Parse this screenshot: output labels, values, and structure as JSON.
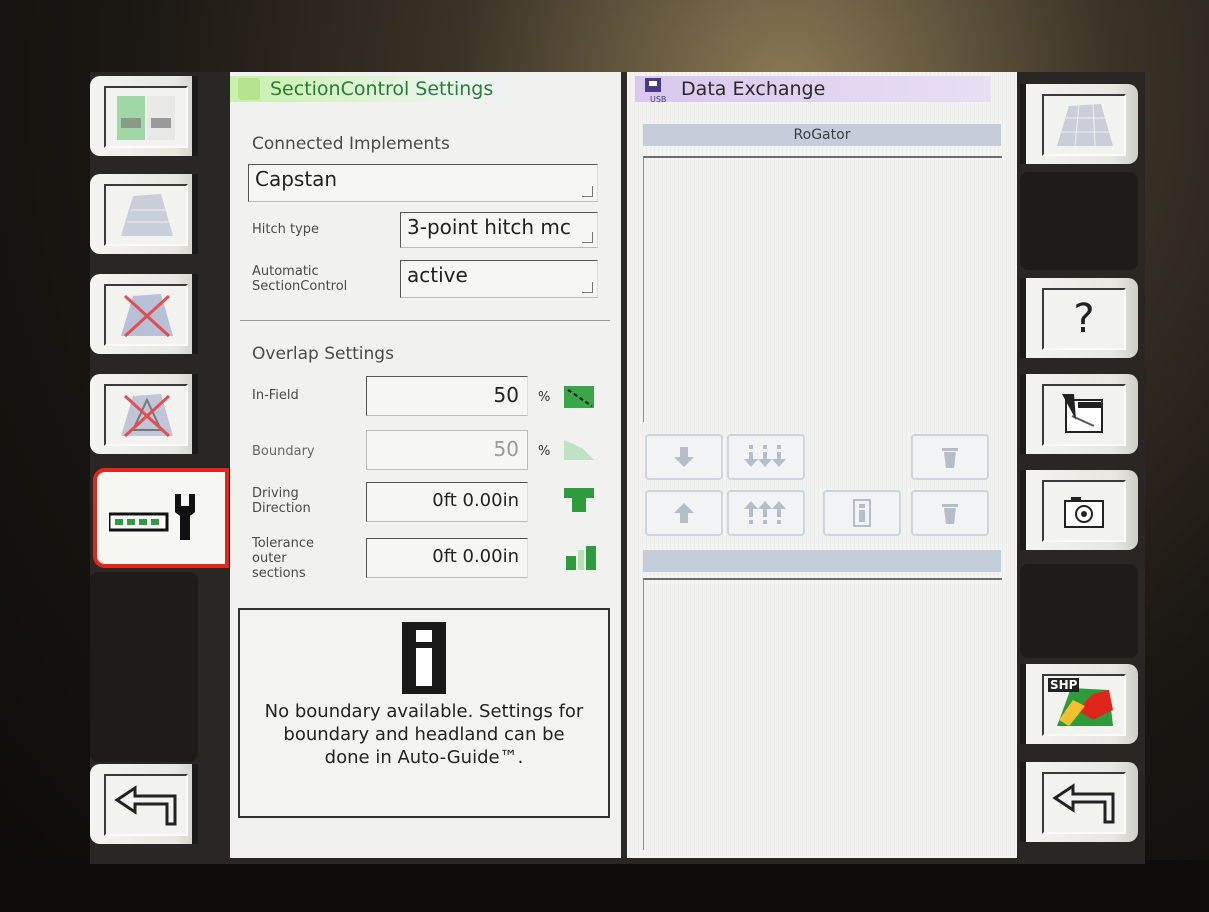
{
  "left_panel": {
    "title": "SectionControl Settings",
    "connected_implements_label": "Connected Implements",
    "implement_value": "Capstan",
    "hitch_type_label": "Hitch type",
    "hitch_type_value": "3-point hitch mc",
    "auto_sc_label_line1": "Automatic",
    "auto_sc_label_line2": "SectionControl",
    "auto_sc_value": "active",
    "overlap_heading": "Overlap Settings",
    "in_field_label": "In-Field",
    "in_field_value": "50",
    "in_field_unit": "%",
    "boundary_label": "Boundary",
    "boundary_value": "50",
    "boundary_unit": "%",
    "driving_direction_label_line1": "Driving",
    "driving_direction_label_line2": "Direction",
    "driving_direction_value": "0ft 0.00in",
    "tolerance_label_line1": "Tolerance",
    "tolerance_label_line2": "outer",
    "tolerance_label_line3": "sections",
    "tolerance_value": "0ft 0.00in",
    "info_message": "No boundary available. Settings for boundary and headland can be done in Auto-Guide™."
  },
  "right_panel": {
    "title": "Data Exchange",
    "usb_label": "USB",
    "list_header": "RoGator"
  },
  "right_softkeys": {
    "help_label": "?",
    "shp_label": "SHP"
  },
  "colors": {
    "green_accent": "#2e9b3c",
    "selected_outline": "#e1261c",
    "header_blue": "#c4cdd9"
  }
}
